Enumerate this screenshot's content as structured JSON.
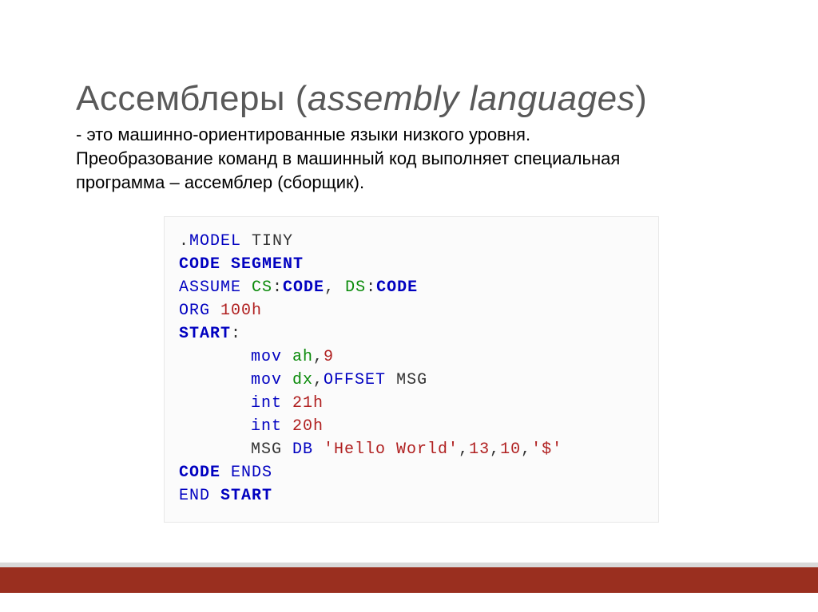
{
  "title": {
    "main": "Ассемблеры ",
    "paren_open": "(",
    "latin": "assembly languages",
    "paren_close": ")"
  },
  "subtitle": "- это машинно-ориентированные языки низкого уровня. Преобразование команд в машинный код выполняет специальная программа – ассемблер (сборщик).",
  "code": {
    "l1_dot": ".",
    "l1_model": "MODEL",
    "l1_tiny": " TINY",
    "l2_code": "CODE",
    "l2_segment": " SEGMENT",
    "l3_assume": "ASSUME",
    "l3_cs": " CS",
    "l3_colon1": ":",
    "l3_code1": "CODE",
    "l3_comma": ",",
    "l3_ds": " DS",
    "l3_colon2": ":",
    "l3_code2": "CODE",
    "l4_org": "ORG",
    "l4_val": " 100h",
    "l5_start": "START",
    "l5_colon": ":",
    "l6_mov": "mov",
    "l6_ah": " ah",
    "l6_comma": ",",
    "l6_9": "9",
    "l7_mov": "mov",
    "l7_dx": " dx",
    "l7_comma": ",",
    "l7_offset": "OFFSET",
    "l7_msg": " MSG",
    "l8_int": "int",
    "l8_val": " 21h",
    "l9_int": "int",
    "l9_val": " 20h",
    "l10_msg": "MSG ",
    "l10_db": "DB",
    "l10_str": " 'Hello World'",
    "l10_comma1": ",",
    "l10_13": "13",
    "l10_comma2": ",",
    "l10_10": "10",
    "l10_comma3": ",",
    "l10_dollar": "'$'",
    "l11_code": "CODE",
    "l11_ends": " ENDS",
    "l12_end": "END",
    "l12_start": " START"
  }
}
